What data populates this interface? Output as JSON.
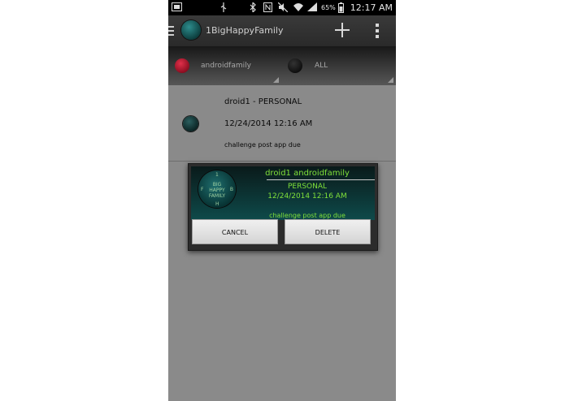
{
  "status_bar": {
    "battery_percent": "65%",
    "time": "12:17 AM"
  },
  "action_bar": {
    "title": "1BigHappyFamily"
  },
  "filters": {
    "family": "androidfamily",
    "member": "ALL"
  },
  "list": {
    "items": [
      {
        "title": "droid1 - PERSONAL",
        "date": "12/24/2014 12:16 AM",
        "note": "challenge post app due"
      }
    ]
  },
  "dialog": {
    "logo_text": [
      "BIG",
      "HAPPY",
      "FAMILY"
    ],
    "logo_corners": [
      "1",
      "F",
      "B",
      "H"
    ],
    "title": "droid1 androidfamily",
    "category": "PERSONAL",
    "date": "12/24/2014 12:16 AM",
    "note": "challenge post app due",
    "cancel_label": "CANCEL",
    "delete_label": "DELETE"
  },
  "colors": {
    "accent_green": "#7fe03a",
    "teal": "#0e4a4a",
    "family_dot": "#e0304a"
  }
}
